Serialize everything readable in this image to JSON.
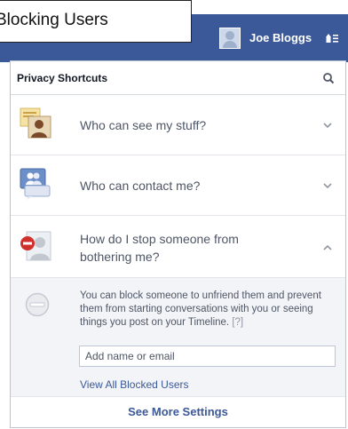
{
  "callout": {
    "text": "Blocking Users"
  },
  "header": {
    "username": "Joe Bloggs",
    "brand_color": "#3b5998"
  },
  "panel": {
    "title": "Privacy Shortcuts",
    "search_icon": "search-icon",
    "items": [
      {
        "label": "Who can see my stuff?",
        "icon": "photo-person-icon",
        "expanded": false
      },
      {
        "label": "Who can contact me?",
        "icon": "chat-person-icon",
        "expanded": false
      },
      {
        "label": "How do I stop someone from bothering me?",
        "icon": "block-person-icon",
        "expanded": true
      }
    ],
    "blocking": {
      "description": "You can block someone to unfriend them and prevent them from starting conversations with you or seeing things you post on your Timeline.",
      "help": "[?]",
      "input_placeholder": "Add name or email",
      "view_all": "View All Blocked Users"
    },
    "footer": "See More Settings"
  }
}
